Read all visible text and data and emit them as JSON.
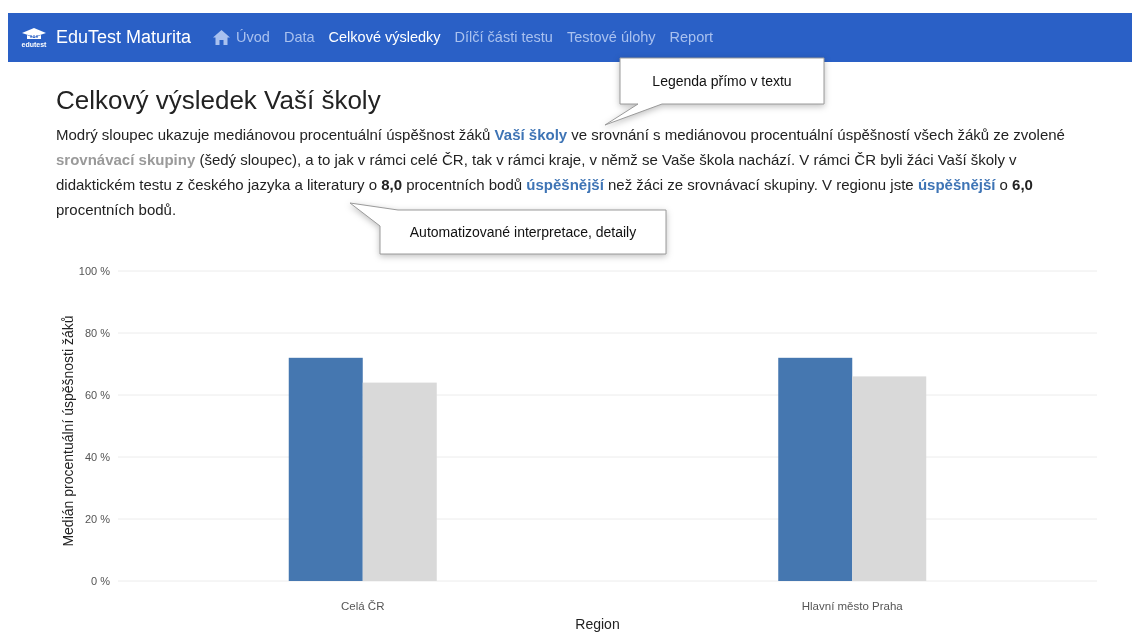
{
  "navbar": {
    "brand": {
      "title": "EduTest Maturita",
      "logo_caption": "edutest"
    },
    "items": [
      {
        "label": "Úvod",
        "selected": false,
        "kind": "home"
      },
      {
        "label": "Data",
        "selected": false
      },
      {
        "label": "Celkové výsledky",
        "selected": true
      },
      {
        "label": "Dílčí části testu",
        "selected": false
      },
      {
        "label": "Testové úlohy",
        "selected": false
      },
      {
        "label": "Report",
        "selected": false
      }
    ]
  },
  "heading": "Celkový výsledek Vaší školy",
  "paragraph": [
    {
      "kind": "text",
      "text": "Modrý sloupec ukazuje mediánovou procentuální úspěšnost žáků "
    },
    {
      "kind": "school",
      "text": "Vaší školy"
    },
    {
      "kind": "text",
      "text": " ve srovnání s mediánovou procentuální úspěšností všech žáků ze zvolené "
    },
    {
      "kind": "group",
      "text": "srovnávací skupiny"
    },
    {
      "kind": "text",
      "text": " (šedý sloupec), a to jak v rámci celé ČR, tak v rámci kraje, v němž se Vaše škola nachází. V rámci ČR byli žáci Vaší školy v didaktickém testu z českého jazyka a literatury o "
    },
    {
      "kind": "number",
      "text": "8,0"
    },
    {
      "kind": "text",
      "text": " procentních bodů "
    },
    {
      "kind": "school",
      "text": "úspěšnější"
    },
    {
      "kind": "text",
      "text": " než žáci ze srovnávací skupiny. V regionu jste "
    },
    {
      "kind": "school",
      "text": "úspěšnější"
    },
    {
      "kind": "text",
      "text": " o "
    },
    {
      "kind": "number",
      "text": "6,0"
    },
    {
      "kind": "text",
      "text": " procentních bodů."
    }
  ],
  "chart": {
    "chart_data": {
      "type": "bar",
      "xlabel": "Region",
      "ylabel": "Medián procentuální úspěšnosti žáků",
      "categories": [
        "Celá ČR",
        "Hlavní město Praha"
      ],
      "series": [
        {
          "color": "#4577b0",
          "values": [
            72,
            72
          ]
        },
        {
          "color": "#d9d9d9",
          "values": [
            64,
            66
          ]
        }
      ],
      "ylim": [
        0,
        100
      ],
      "grid": true,
      "yticks": [
        {
          "value": 0,
          "label": "0 %"
        },
        {
          "value": 20,
          "label": "20 %"
        },
        {
          "value": 40,
          "label": "40 %"
        },
        {
          "value": 60,
          "label": "60 %"
        },
        {
          "value": 80,
          "label": "80 %"
        },
        {
          "value": 100,
          "label": "100 %"
        }
      ]
    }
  },
  "callouts": [
    {
      "text": "Legenda přímo v textu",
      "kind": "down"
    },
    {
      "text": "Automatizované interpretace, detaily",
      "kind": "up"
    }
  ]
}
